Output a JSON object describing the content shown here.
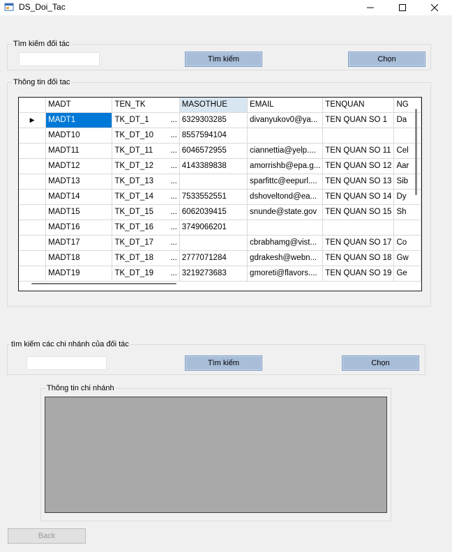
{
  "window": {
    "title": "DS_Doi_Tac"
  },
  "search_partner": {
    "group_label": "Tìm kiếm đối tác",
    "input_value": "",
    "search_label": "Tìm kiếm",
    "choose_label": "Chọn"
  },
  "partner_info": {
    "group_label": "Thông tin đối tac",
    "columns": [
      "MADT",
      "TEN_TK",
      "MASOTHUE",
      "EMAIL",
      "TENQUAN",
      "NG"
    ],
    "rows": [
      [
        "MADT1",
        "TK_DT_1",
        "6329303285",
        "divanyukov0@ya...",
        "TEN QUAN SO 1",
        "Da"
      ],
      [
        "MADT10",
        "TK_DT_10",
        "8557594104",
        "",
        "",
        ""
      ],
      [
        "MADT11",
        "TK_DT_11",
        "6046572955",
        "ciannettia@yelp....",
        "TEN QUAN SO 11",
        "Cel"
      ],
      [
        "MADT12",
        "TK_DT_12",
        "4143389838",
        "amorrishb@epa.g...",
        "TEN QUAN SO 12",
        "Aar"
      ],
      [
        "MADT13",
        "TK_DT_13",
        "",
        "sparfittc@eepurl....",
        "TEN QUAN SO 13",
        "Sib"
      ],
      [
        "MADT14",
        "TK_DT_14",
        "7533552551",
        "dshoveltond@ea...",
        "TEN QUAN SO 14",
        "Dy"
      ],
      [
        "MADT15",
        "TK_DT_15",
        "6062039415",
        "snunde@state.gov",
        "TEN QUAN SO 15",
        "Sh"
      ],
      [
        "MADT16",
        "TK_DT_16",
        "3749066201",
        "",
        "",
        ""
      ],
      [
        "MADT17",
        "TK_DT_17",
        "",
        "cbrabhamg@vist...",
        "TEN QUAN SO 17",
        "Co"
      ],
      [
        "MADT18",
        "TK_DT_18",
        "2777071284",
        "gdrakesh@webn...",
        "TEN QUAN SO 18",
        "Gw"
      ],
      [
        "MADT19",
        "TK_DT_19",
        "3219273683",
        "gmoreti@flavors....",
        "TEN QUAN SO 19",
        "Ge"
      ]
    ],
    "current_row_indicator": "▶"
  },
  "search_branch": {
    "group_label": "tìm kiếm các chi nhánh của đối tác",
    "input_value": "",
    "search_label": "Tìm kiếm",
    "choose_label": "Chọn"
  },
  "branch_info": {
    "group_label": "Thông tin chi nhánh"
  },
  "back_label": "Back",
  "colors": {
    "selection": "#0078d7",
    "button": "#a8bdd8",
    "panel": "#a9a9a9"
  }
}
